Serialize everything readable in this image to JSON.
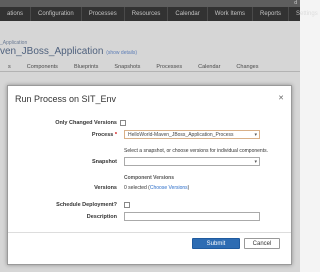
{
  "topbar": {
    "user": "d"
  },
  "mainnav": {
    "items": [
      "ations",
      "Configuration",
      "Processes",
      "Resources",
      "Calendar",
      "Work Items",
      "Reports",
      "Settings"
    ]
  },
  "breadcrumb": "_Application",
  "app_title": "ven_JBoss_Application",
  "show_details": "(show details)",
  "subnav": {
    "items": [
      "s",
      "Components",
      "Blueprints",
      "Snapshots",
      "Processes",
      "Calendar",
      "Changes"
    ]
  },
  "dialog": {
    "title": "Run Process on SIT_Env",
    "close": "✕",
    "only_changed_label": "Only Changed Versions",
    "process_label": "Process",
    "process_required": "*",
    "process_value": "HelloWorld-Maven_JBoss_Application_Process",
    "process_hint": "Select a snapshot, or choose versions for individual components.",
    "snapshot_label": "Snapshot",
    "component_versions": "Component Versions",
    "versions_label": "Versions",
    "versions_value": "0 selected (",
    "choose_versions": "Choose Versions",
    "versions_close": ")",
    "schedule_label": "Schedule Deployment?",
    "description_label": "Description",
    "submit": "Submit",
    "cancel": "Cancel"
  },
  "colors": {
    "primary_button": "#2d6cb3",
    "link": "#2a6cc8",
    "nav_bg": "#3a3a3a"
  }
}
